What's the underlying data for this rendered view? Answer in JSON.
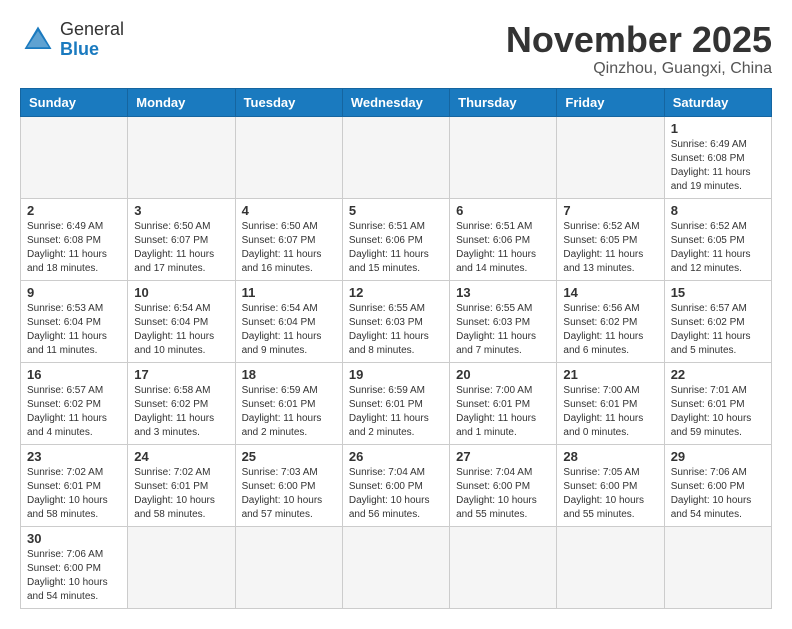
{
  "header": {
    "logo": {
      "general": "General",
      "blue": "Blue"
    },
    "title": "November 2025",
    "location": "Qinzhou, Guangxi, China"
  },
  "weekdays": [
    "Sunday",
    "Monday",
    "Tuesday",
    "Wednesday",
    "Thursday",
    "Friday",
    "Saturday"
  ],
  "weeks": [
    [
      {
        "day": "",
        "info": ""
      },
      {
        "day": "",
        "info": ""
      },
      {
        "day": "",
        "info": ""
      },
      {
        "day": "",
        "info": ""
      },
      {
        "day": "",
        "info": ""
      },
      {
        "day": "",
        "info": ""
      },
      {
        "day": "1",
        "info": "Sunrise: 6:49 AM\nSunset: 6:08 PM\nDaylight: 11 hours\nand 19 minutes."
      }
    ],
    [
      {
        "day": "2",
        "info": "Sunrise: 6:49 AM\nSunset: 6:08 PM\nDaylight: 11 hours\nand 18 minutes."
      },
      {
        "day": "3",
        "info": "Sunrise: 6:50 AM\nSunset: 6:07 PM\nDaylight: 11 hours\nand 17 minutes."
      },
      {
        "day": "4",
        "info": "Sunrise: 6:50 AM\nSunset: 6:07 PM\nDaylight: 11 hours\nand 16 minutes."
      },
      {
        "day": "5",
        "info": "Sunrise: 6:51 AM\nSunset: 6:06 PM\nDaylight: 11 hours\nand 15 minutes."
      },
      {
        "day": "6",
        "info": "Sunrise: 6:51 AM\nSunset: 6:06 PM\nDaylight: 11 hours\nand 14 minutes."
      },
      {
        "day": "7",
        "info": "Sunrise: 6:52 AM\nSunset: 6:05 PM\nDaylight: 11 hours\nand 13 minutes."
      },
      {
        "day": "8",
        "info": "Sunrise: 6:52 AM\nSunset: 6:05 PM\nDaylight: 11 hours\nand 12 minutes."
      }
    ],
    [
      {
        "day": "9",
        "info": "Sunrise: 6:53 AM\nSunset: 6:04 PM\nDaylight: 11 hours\nand 11 minutes."
      },
      {
        "day": "10",
        "info": "Sunrise: 6:54 AM\nSunset: 6:04 PM\nDaylight: 11 hours\nand 10 minutes."
      },
      {
        "day": "11",
        "info": "Sunrise: 6:54 AM\nSunset: 6:04 PM\nDaylight: 11 hours\nand 9 minutes."
      },
      {
        "day": "12",
        "info": "Sunrise: 6:55 AM\nSunset: 6:03 PM\nDaylight: 11 hours\nand 8 minutes."
      },
      {
        "day": "13",
        "info": "Sunrise: 6:55 AM\nSunset: 6:03 PM\nDaylight: 11 hours\nand 7 minutes."
      },
      {
        "day": "14",
        "info": "Sunrise: 6:56 AM\nSunset: 6:02 PM\nDaylight: 11 hours\nand 6 minutes."
      },
      {
        "day": "15",
        "info": "Sunrise: 6:57 AM\nSunset: 6:02 PM\nDaylight: 11 hours\nand 5 minutes."
      }
    ],
    [
      {
        "day": "16",
        "info": "Sunrise: 6:57 AM\nSunset: 6:02 PM\nDaylight: 11 hours\nand 4 minutes."
      },
      {
        "day": "17",
        "info": "Sunrise: 6:58 AM\nSunset: 6:02 PM\nDaylight: 11 hours\nand 3 minutes."
      },
      {
        "day": "18",
        "info": "Sunrise: 6:59 AM\nSunset: 6:01 PM\nDaylight: 11 hours\nand 2 minutes."
      },
      {
        "day": "19",
        "info": "Sunrise: 6:59 AM\nSunset: 6:01 PM\nDaylight: 11 hours\nand 2 minutes."
      },
      {
        "day": "20",
        "info": "Sunrise: 7:00 AM\nSunset: 6:01 PM\nDaylight: 11 hours\nand 1 minute."
      },
      {
        "day": "21",
        "info": "Sunrise: 7:00 AM\nSunset: 6:01 PM\nDaylight: 11 hours\nand 0 minutes."
      },
      {
        "day": "22",
        "info": "Sunrise: 7:01 AM\nSunset: 6:01 PM\nDaylight: 10 hours\nand 59 minutes."
      }
    ],
    [
      {
        "day": "23",
        "info": "Sunrise: 7:02 AM\nSunset: 6:01 PM\nDaylight: 10 hours\nand 58 minutes."
      },
      {
        "day": "24",
        "info": "Sunrise: 7:02 AM\nSunset: 6:01 PM\nDaylight: 10 hours\nand 58 minutes."
      },
      {
        "day": "25",
        "info": "Sunrise: 7:03 AM\nSunset: 6:00 PM\nDaylight: 10 hours\nand 57 minutes."
      },
      {
        "day": "26",
        "info": "Sunrise: 7:04 AM\nSunset: 6:00 PM\nDaylight: 10 hours\nand 56 minutes."
      },
      {
        "day": "27",
        "info": "Sunrise: 7:04 AM\nSunset: 6:00 PM\nDaylight: 10 hours\nand 55 minutes."
      },
      {
        "day": "28",
        "info": "Sunrise: 7:05 AM\nSunset: 6:00 PM\nDaylight: 10 hours\nand 55 minutes."
      },
      {
        "day": "29",
        "info": "Sunrise: 7:06 AM\nSunset: 6:00 PM\nDaylight: 10 hours\nand 54 minutes."
      }
    ],
    [
      {
        "day": "30",
        "info": "Sunrise: 7:06 AM\nSunset: 6:00 PM\nDaylight: 10 hours\nand 54 minutes."
      },
      {
        "day": "",
        "info": ""
      },
      {
        "day": "",
        "info": ""
      },
      {
        "day": "",
        "info": ""
      },
      {
        "day": "",
        "info": ""
      },
      {
        "day": "",
        "info": ""
      },
      {
        "day": "",
        "info": ""
      }
    ]
  ]
}
